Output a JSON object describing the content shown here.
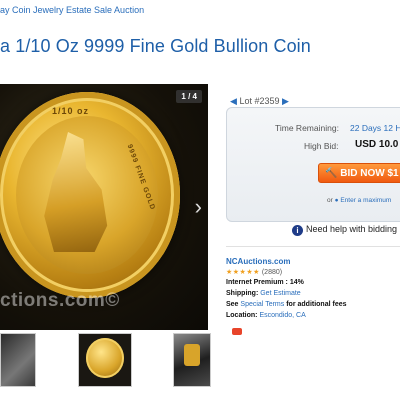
{
  "breadcrumb": "ay Coin Jewelry Estate Sale Auction",
  "title": "a 1/10 Oz 9999 Fine Gold Bullion Coin",
  "gallery": {
    "counter": "1 / 4",
    "watermark": "ctions.com©",
    "coin_text_top": "1/10 oz",
    "coin_text_side": "9999 FINE GOLD"
  },
  "lot": {
    "label": "Lot #2359",
    "prev_icon": "left-triangle-icon",
    "next_icon": "right-triangle-icon"
  },
  "bidding": {
    "time_label": "Time Remaining:",
    "time_value": "22 Days 12 H",
    "high_label": "High Bid:",
    "high_value": "USD 10.0",
    "bid_button": "BID NOW $1",
    "max_or": "or",
    "max_link": "Enter a maximum"
  },
  "help": {
    "text": "Need help with bidding"
  },
  "seller": {
    "name": "NCAuctions.com",
    "stars": "★★★★★",
    "reviews": "(2880)",
    "premium_label": "Internet Premium :",
    "premium_value": "14%",
    "shipping_label": "Shipping:",
    "shipping_value": "Get Estimate",
    "see_label": "See",
    "special_terms": "Special Terms",
    "additional": "for additional fees",
    "location_label": "Location:",
    "location_value": "Escondido, CA"
  },
  "colors": {
    "link": "#2a6ebb",
    "bid_button": "#f05a10",
    "stars": "#f0a020"
  }
}
